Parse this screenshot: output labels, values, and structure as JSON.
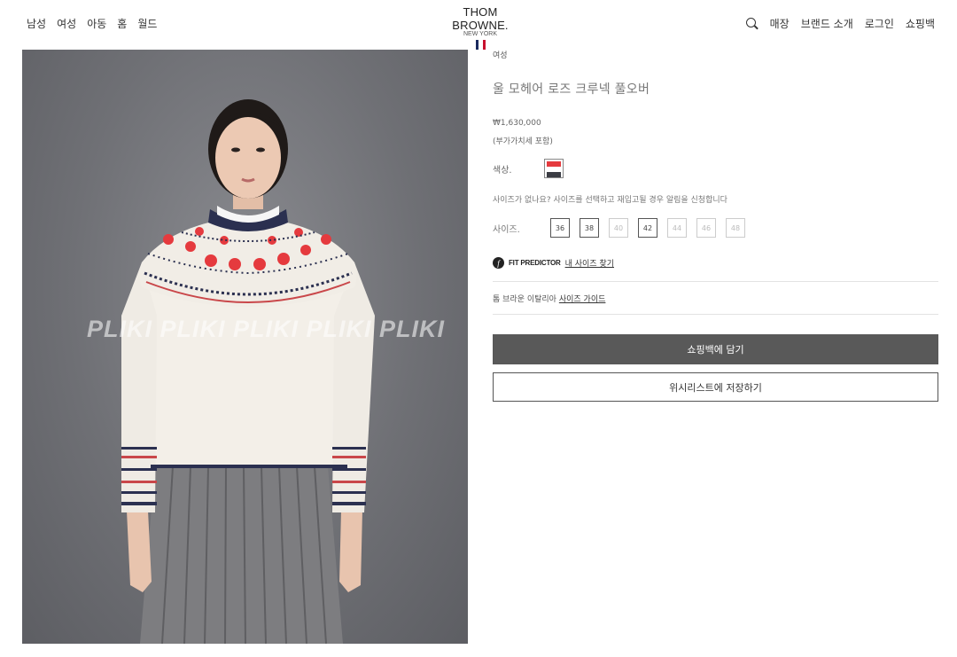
{
  "header": {
    "nav_left": [
      "남성",
      "여성",
      "아동",
      "홈",
      "월드"
    ],
    "logo": {
      "main": "THOM BROWNE.",
      "sub": "NEW YORK"
    },
    "flag_colors": [
      "#1a2a5e",
      "#ffffff",
      "#c8102e"
    ],
    "nav_right": [
      "매장",
      "브랜드 소개",
      "로그인",
      "쇼핑백"
    ],
    "search_icon": "search-icon"
  },
  "product": {
    "breadcrumb": "여성",
    "title": "울 모헤어 로즈 크루넥 풀오버",
    "price": "₩1,630,000",
    "vat_note": "(부가가치세 포함)",
    "color_label": "색상.",
    "swatch_colors": [
      "#e53a3e",
      "#ffffff",
      "#3b3d44"
    ],
    "size_notice": "사이즈가 없나요? 사이즈를 선택하고 재입고될 경우 알림을 신청합니다",
    "size_label": "사이즈.",
    "sizes": [
      {
        "label": "36",
        "available": true
      },
      {
        "label": "38",
        "available": true
      },
      {
        "label": "40",
        "available": false
      },
      {
        "label": "42",
        "available": true
      },
      {
        "label": "44",
        "available": false
      },
      {
        "label": "46",
        "available": false
      },
      {
        "label": "48",
        "available": false
      }
    ],
    "fit_predictor": {
      "icon": "f",
      "brand": "FIT PREDICTOR",
      "link": "내 사이즈 찾기"
    },
    "size_guide": {
      "prefix": "톰 브라운 이탈리아",
      "link": "사이즈 가이드"
    },
    "add_to_bag": "쇼핑백에 담기",
    "add_to_wishlist": "위시리스트에 저장하기"
  },
  "watermark": "PLIKI    PLIKI    PLIKI    PLIKI    PLIKI"
}
